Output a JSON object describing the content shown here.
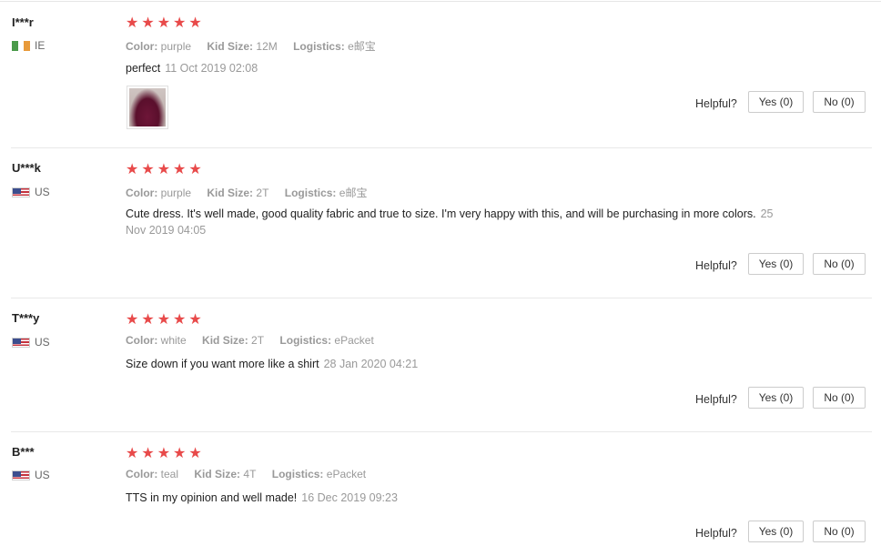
{
  "reviews": [
    {
      "user": "I***r",
      "country": "IE",
      "flag": "ireland-flag",
      "stars": 5,
      "color_label": "Color:",
      "color": "purple",
      "size_label": "Kid Size:",
      "size": "12M",
      "logistics_label": "Logistics:",
      "logistics": "e邮宝",
      "text": "perfect",
      "date": "11 Oct 2019 02:08",
      "has_photo": true,
      "helpful_label": "Helpful?",
      "yes_label": "Yes (0)",
      "no_label": "No (0)"
    },
    {
      "user": "U***k",
      "country": "US",
      "flag": "us-flag",
      "stars": 5,
      "color_label": "Color:",
      "color": "purple",
      "size_label": "Kid Size:",
      "size": "2T",
      "logistics_label": "Logistics:",
      "logistics": "e邮宝",
      "text": "Cute dress. It's well made, good quality fabric and true to size. I'm very happy with this, and will be purchasing in more colors.",
      "date": "25 Nov 2019 04:05",
      "has_photo": false,
      "helpful_label": "Helpful?",
      "yes_label": "Yes (0)",
      "no_label": "No (0)"
    },
    {
      "user": "T***y",
      "country": "US",
      "flag": "us-flag",
      "stars": 5,
      "color_label": "Color:",
      "color": "white",
      "size_label": "Kid Size:",
      "size": "2T",
      "logistics_label": "Logistics:",
      "logistics": "ePacket",
      "text": "Size down if you want more like a shirt",
      "date": "28 Jan 2020 04:21",
      "has_photo": false,
      "helpful_label": "Helpful?",
      "yes_label": "Yes (0)",
      "no_label": "No (0)"
    },
    {
      "user": "B***",
      "country": "US",
      "flag": "us-flag",
      "stars": 5,
      "color_label": "Color:",
      "color": "teal",
      "size_label": "Kid Size:",
      "size": "4T",
      "logistics_label": "Logistics:",
      "logistics": "ePacket",
      "text": "TTS in my opinion and well made!",
      "date": "16 Dec 2019 09:23",
      "has_photo": false,
      "helpful_label": "Helpful?",
      "yes_label": "Yes (0)",
      "no_label": "No (0)"
    }
  ],
  "colors": {
    "star": "#e84a4a",
    "muted": "#999999",
    "text": "#222222",
    "border": "#cccccc"
  }
}
